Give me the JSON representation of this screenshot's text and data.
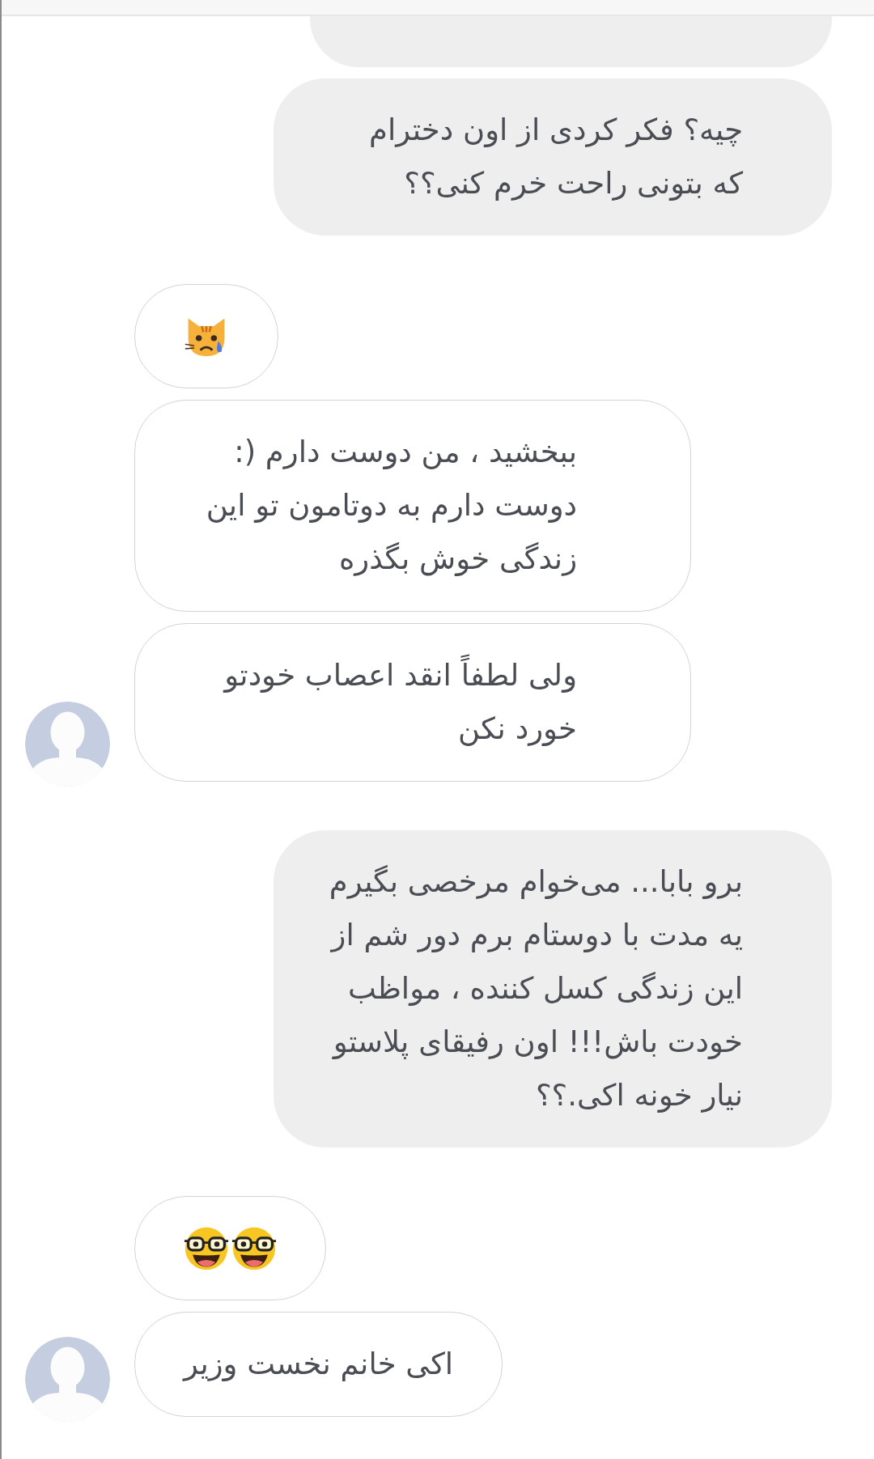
{
  "groups": [
    {
      "kind": "outgoing",
      "messages": [
        {
          "kind": "text",
          "text": "چیه؟ فکر کردی از اون دخترام\nکه بتونی راحت خرم کنی؟؟"
        }
      ]
    },
    {
      "kind": "incoming",
      "messages": [
        {
          "kind": "emoji",
          "emoji": [
            {
              "kind": "cat"
            }
          ]
        },
        {
          "kind": "text",
          "text": "ببخشید ، من دوست دارم (:\nدوست دارم به دوتامون تو این\nزندگی خوش بگذره"
        },
        {
          "kind": "text",
          "text": "ولی لطفاً انقد اعصاب خودتو\nخورد نکن"
        }
      ]
    },
    {
      "kind": "outgoing",
      "messages": [
        {
          "kind": "text",
          "text": "برو بابا... می‌خوام مرخصی بگیرم\nیه مدت با دوستام برم دور شم از\nاین زندگی کسل کننده ، مواظب\nخودت باش!!! اون رفیقای پلاستو\nنیار خونه اکی.؟؟"
        }
      ]
    },
    {
      "kind": "incoming",
      "messages": [
        {
          "kind": "emoji",
          "emoji": [
            {
              "kind": "nerd"
            },
            {
              "kind": "nerd"
            }
          ]
        },
        {
          "kind": "text",
          "text": "اکی خانم نخست وزیر"
        }
      ]
    }
  ]
}
